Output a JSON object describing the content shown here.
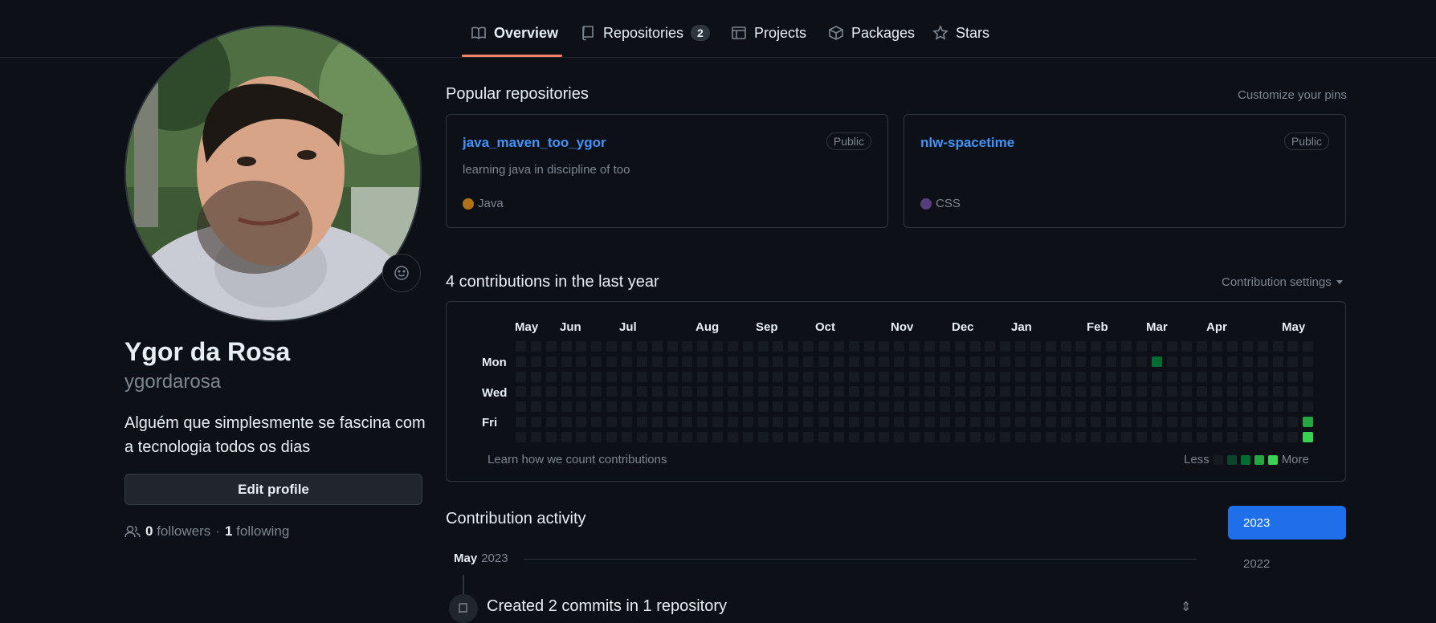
{
  "nav": {
    "tabs": [
      {
        "label": "Overview",
        "icon": "book-icon",
        "active": true
      },
      {
        "label": "Repositories",
        "icon": "repo-icon",
        "counter": "2"
      },
      {
        "label": "Projects",
        "icon": "table-icon"
      },
      {
        "label": "Packages",
        "icon": "package-icon"
      },
      {
        "label": "Stars",
        "icon": "star-icon"
      }
    ]
  },
  "profile": {
    "name": "Ygor da Rosa",
    "login": "ygordarosa",
    "bio": "Alguém que simplesmente se fascina com a tecnologia todos os dias",
    "edit_label": "Edit profile",
    "followers_count": "0",
    "followers_label": "followers",
    "separator": "·",
    "following_count": "1",
    "following_label": "following"
  },
  "pinned": {
    "title": "Popular repositories",
    "customize_label": "Customize your pins",
    "repos": [
      {
        "name": "java_maven_too_ygor",
        "visibility": "Public",
        "description": "learning java in discipline of too",
        "language": "Java",
        "language_color": "#b07219"
      },
      {
        "name": "nlw-spacetime",
        "visibility": "Public",
        "description": "",
        "language": "CSS",
        "language_color": "#563d7c"
      }
    ]
  },
  "contributions": {
    "title": "4 contributions in the last year",
    "settings_label": "Contribution settings",
    "months": [
      "May",
      "Jun",
      "Jul",
      "Aug",
      "Sep",
      "Oct",
      "Nov",
      "Dec",
      "Jan",
      "Feb",
      "Mar",
      "Apr",
      "May"
    ],
    "days": [
      "Mon",
      "Wed",
      "Fri"
    ],
    "learn_link": "Learn how we count contributions",
    "legend_less": "Less",
    "legend_more": "More",
    "legend_colors": [
      "#161b22",
      "#0e4429",
      "#006d32",
      "#26a641",
      "#39d353"
    ],
    "weeks": 53,
    "active_cells": [
      {
        "week": 42,
        "day": 1,
        "level": 2
      },
      {
        "week": 52,
        "day": 5,
        "level": 3
      },
      {
        "week": 52,
        "day": 6,
        "level": 4
      }
    ]
  },
  "activity": {
    "title": "Contribution activity",
    "month_label": "May",
    "year_label": "2023",
    "event_text": "Created 2 commits in 1 repository",
    "years": [
      "2023",
      "2022"
    ]
  }
}
